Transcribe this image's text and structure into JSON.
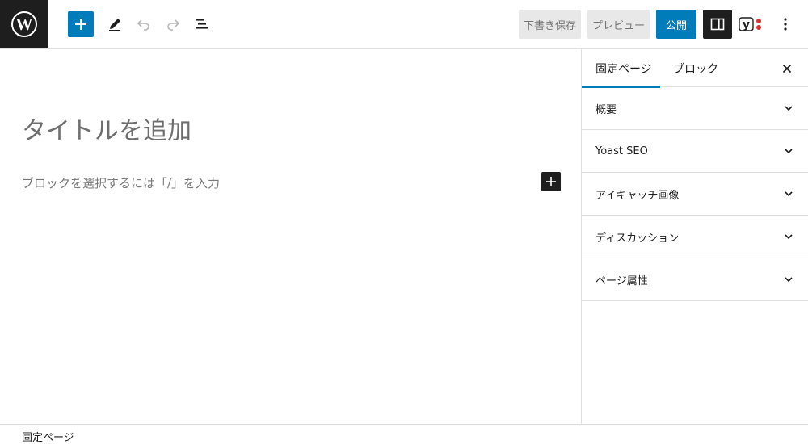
{
  "toolbar": {
    "save_draft_label": "下書き保存",
    "preview_label": "プレビュー",
    "publish_label": "公開",
    "accent_color": "#007cba",
    "dark_color": "#1e1e1e"
  },
  "icons": {
    "logo": "wordpress-logo-icon",
    "inserter": "plus-icon",
    "tools": "pencil-icon",
    "undo": "undo-icon",
    "redo": "redo-icon",
    "list_view": "list-view-icon",
    "settings": "sidebar-toggle-icon",
    "yoast": "yoast-icon",
    "more": "more-vertical-icon",
    "close": "close-icon",
    "chevron": "chevron-down-icon"
  },
  "editor": {
    "title_placeholder": "タイトルを追加",
    "block_placeholder": "ブロックを選択するには「/」を入力"
  },
  "sidebar": {
    "tabs": [
      {
        "label": "固定ページ",
        "active": true
      },
      {
        "label": "ブロック",
        "active": false
      }
    ],
    "panels": [
      {
        "label": "概要"
      },
      {
        "label": "Yoast SEO"
      },
      {
        "label": "アイキャッチ画像"
      },
      {
        "label": "ディスカッション"
      },
      {
        "label": "ページ属性"
      }
    ]
  },
  "footer": {
    "breadcrumb": "固定ページ"
  }
}
